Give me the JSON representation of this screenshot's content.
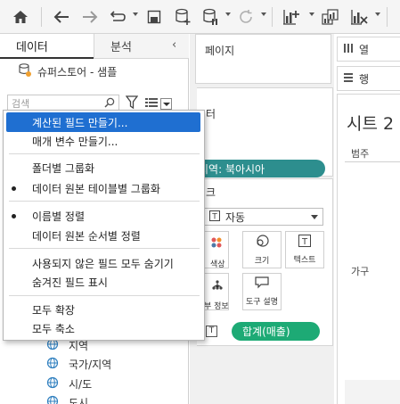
{
  "colors": {
    "menu_highlight": "#1f6fd1",
    "filter_pill": "#2d8e8e",
    "measure_pill": "#1daa75",
    "toolbar_bg": "#f5f5f5"
  },
  "toolbar": {
    "icons": [
      "home-icon",
      "undo-icon",
      "redo-icon",
      "replay-icon",
      "save-icon",
      "new-datasource-icon",
      "pause-icon",
      "refresh-icon",
      "new-worksheet-icon",
      "duplicate-icon",
      "clear-sheet-icon"
    ]
  },
  "left_panel": {
    "tab_data": "데이터",
    "tab_analysis": "분석",
    "collapse_icon": "‹",
    "datasource": "슈퍼스토어 - 샘플",
    "search_placeholder": "검색",
    "fields": [
      "지역",
      "국가/지역",
      "시/도",
      "도시"
    ]
  },
  "menu": {
    "items": [
      {
        "label": "계산된 필드 만들기...",
        "active": true,
        "dot": false
      },
      {
        "label": "매개 변수 만들기...",
        "active": false,
        "dot": false
      },
      {
        "label": "폴더별 그룹화",
        "active": false,
        "dot": false
      },
      {
        "label": "데이터 원본 테이블별 그룹화",
        "active": false,
        "dot": true
      },
      {
        "label": "이름별 정렬",
        "active": false,
        "dot": true
      },
      {
        "label": "데이터 원본 순서별 정렬",
        "active": false,
        "dot": false
      },
      {
        "label": "사용되지 않은 필드 모두 숨기기",
        "active": false,
        "dot": false
      },
      {
        "label": "숨겨진 필드 표시",
        "active": false,
        "dot": false
      },
      {
        "label": "모두 확장",
        "active": false,
        "dot": false
      },
      {
        "label": "모두 축소",
        "active": false,
        "dot": false
      }
    ]
  },
  "cards": {
    "pages_title": "페이지",
    "filters_title": "터",
    "filter_pill": "지역: 북아시아",
    "marks_title": "크",
    "marks_type": "자동",
    "mark_buttons": [
      "색상",
      "크기",
      "텍스트",
      "부 정보",
      "도구 설명"
    ],
    "measure_pill": "합계(매출)"
  },
  "right": {
    "columns_shelf": "열",
    "rows_shelf": "행",
    "sheet_title": "시트 2",
    "header": "범주",
    "row_label": "가구"
  }
}
